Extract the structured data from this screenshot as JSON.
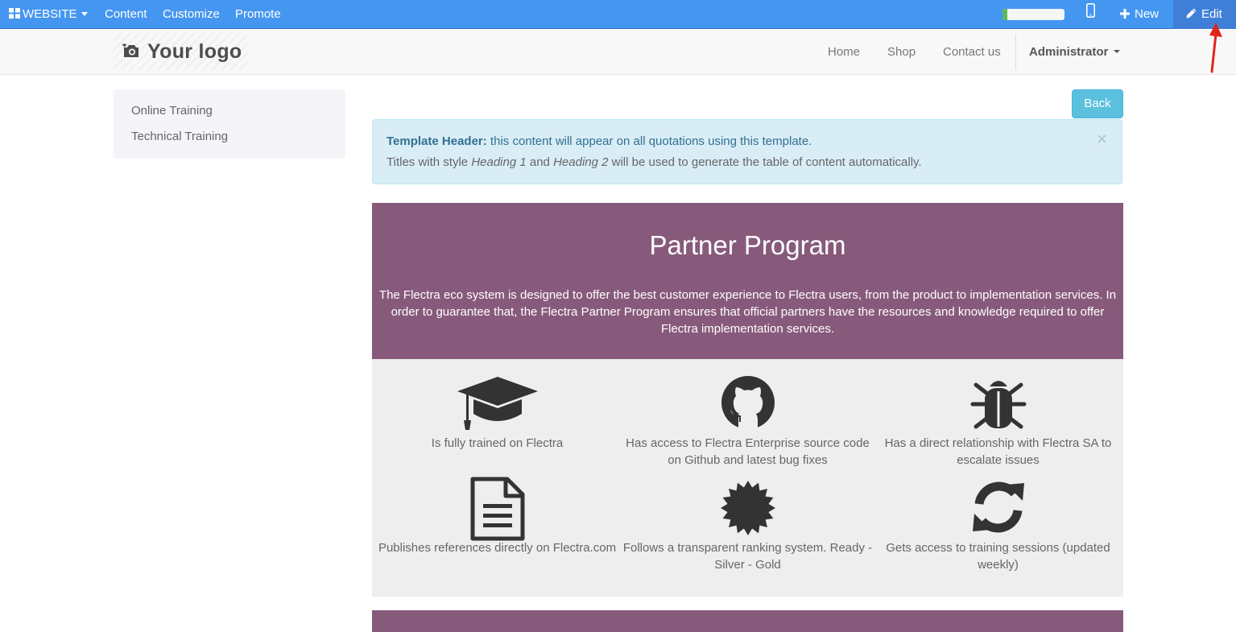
{
  "topbar": {
    "website_label": "WEBSITE",
    "menu": [
      "Content",
      "Customize",
      "Promote"
    ],
    "progress": 0.08,
    "new_label": "New",
    "edit_label": "Edit"
  },
  "header": {
    "logo_text": "Your logo",
    "nav": [
      "Home",
      "Shop",
      "Contact us"
    ],
    "user": "Administrator"
  },
  "sidebar": {
    "items": [
      "Online Training",
      "Technical Training"
    ]
  },
  "back_label": "Back",
  "alert": {
    "title": "Template Header:",
    "line1_rest": " this content will appear on all quotations using this template.",
    "line2_a": "Titles with style ",
    "line2_h1": "Heading 1",
    "line2_and": " and ",
    "line2_h2": "Heading 2",
    "line2_b": " will be used to generate the table of content automatically.",
    "close": "×"
  },
  "banner": {
    "title": "Partner Program",
    "text": "The Flectra eco system is designed to offer the best customer experience to Flectra users, from the product to implementation services. In order to guarantee that, the Flectra Partner Program ensures that official partners have the resources and knowledge required to offer Flectra implementation services."
  },
  "features": [
    {
      "icon": "graduation-cap-icon",
      "label": "Is fully trained on Flectra"
    },
    {
      "icon": "github-icon",
      "label": "Has access to Flectra Enterprise source code on Github and latest bug fixes"
    },
    {
      "icon": "bug-icon",
      "label": "Has a direct relationship with Flectra SA to escalate issues"
    },
    {
      "icon": "document-icon",
      "label": "Publishes references directly on Flectra.com"
    },
    {
      "icon": "certificate-icon",
      "label": "Follows a transparent ranking system. Ready - Silver - Gold"
    },
    {
      "icon": "refresh-icon",
      "label": "Gets access to training sessions (updated weekly)"
    }
  ],
  "colors": {
    "topbar": "#4596f0",
    "brand_purple": "#875a7b",
    "alert_bg": "#d9edf7",
    "info_button": "#5bc0de"
  }
}
